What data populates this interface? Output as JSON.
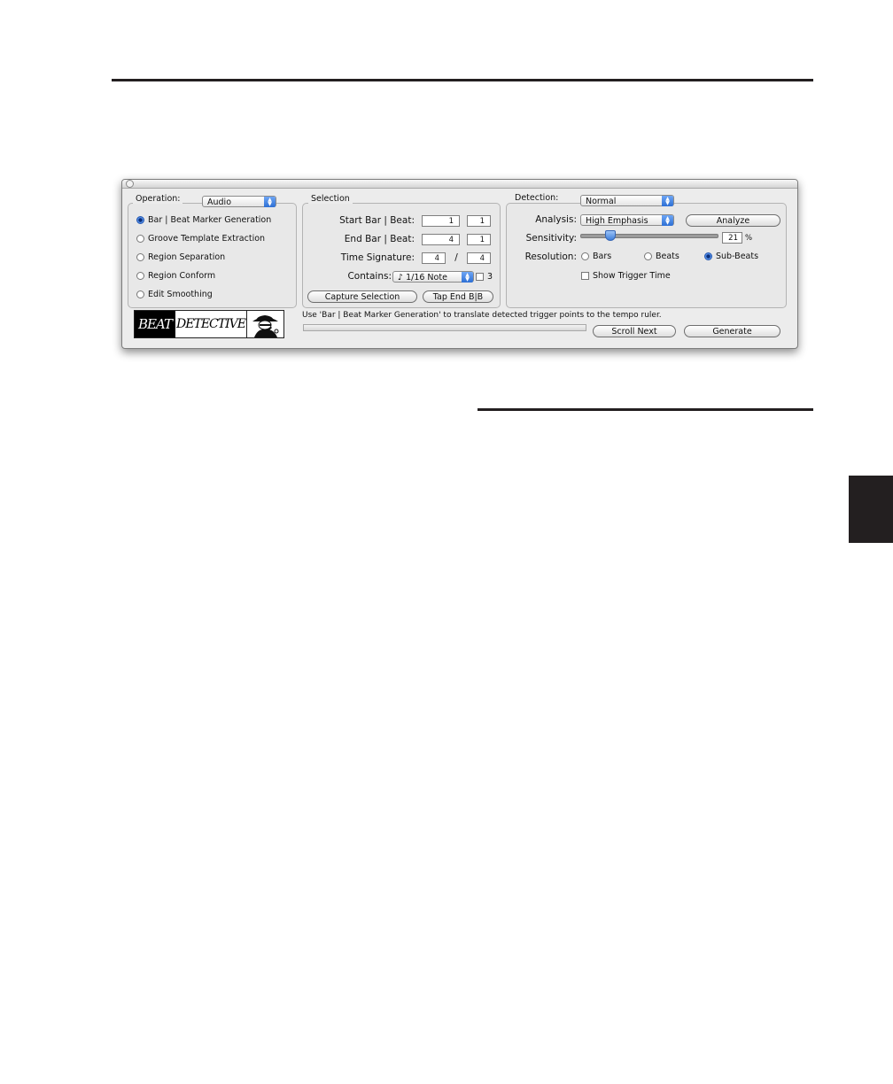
{
  "window": {
    "operation": {
      "label": "Operation:",
      "popup_value": "Audio",
      "options": [
        {
          "label": "Bar | Beat Marker Generation",
          "selected": true
        },
        {
          "label": "Groove Template Extraction",
          "selected": false
        },
        {
          "label": "Region Separation",
          "selected": false
        },
        {
          "label": "Region Conform",
          "selected": false
        },
        {
          "label": "Edit Smoothing",
          "selected": false
        }
      ]
    },
    "selection": {
      "label": "Selection",
      "start_label": "Start Bar | Beat:",
      "start_bar": "1",
      "start_beat": "1",
      "end_label": "End Bar | Beat:",
      "end_bar": "4",
      "end_beat": "1",
      "timesig_label": "Time Signature:",
      "timesig_num": "4",
      "timesig_sep": "/",
      "timesig_den": "4",
      "contains_label": "Contains:",
      "contains_value": "♪ 1/16 Note",
      "triplet_label": "3",
      "capture_button": "Capture Selection",
      "tap_button": "Tap End B|B"
    },
    "detection": {
      "label": "Detection:",
      "mode_value": "Normal",
      "analysis_label": "Analysis:",
      "analysis_value": "High Emphasis",
      "analyze_button": "Analyze",
      "sensitivity_label": "Sensitivity:",
      "sensitivity_value": "21",
      "sensitivity_unit": "%",
      "sensitivity_fraction": 0.21,
      "resolution_label": "Resolution:",
      "resolution_options": [
        {
          "label": "Bars",
          "selected": false
        },
        {
          "label": "Beats",
          "selected": false
        },
        {
          "label": "Sub-Beats",
          "selected": true
        }
      ],
      "show_trigger_label": "Show Trigger Time",
      "show_trigger_checked": false
    },
    "logo": {
      "beat": "BEAT",
      "detective": "DETECTIVE"
    },
    "status_text": "Use 'Bar | Beat Marker Generation' to translate detected trigger points to the tempo ruler.",
    "scroll_next_button": "Scroll Next",
    "generate_button": "Generate"
  }
}
